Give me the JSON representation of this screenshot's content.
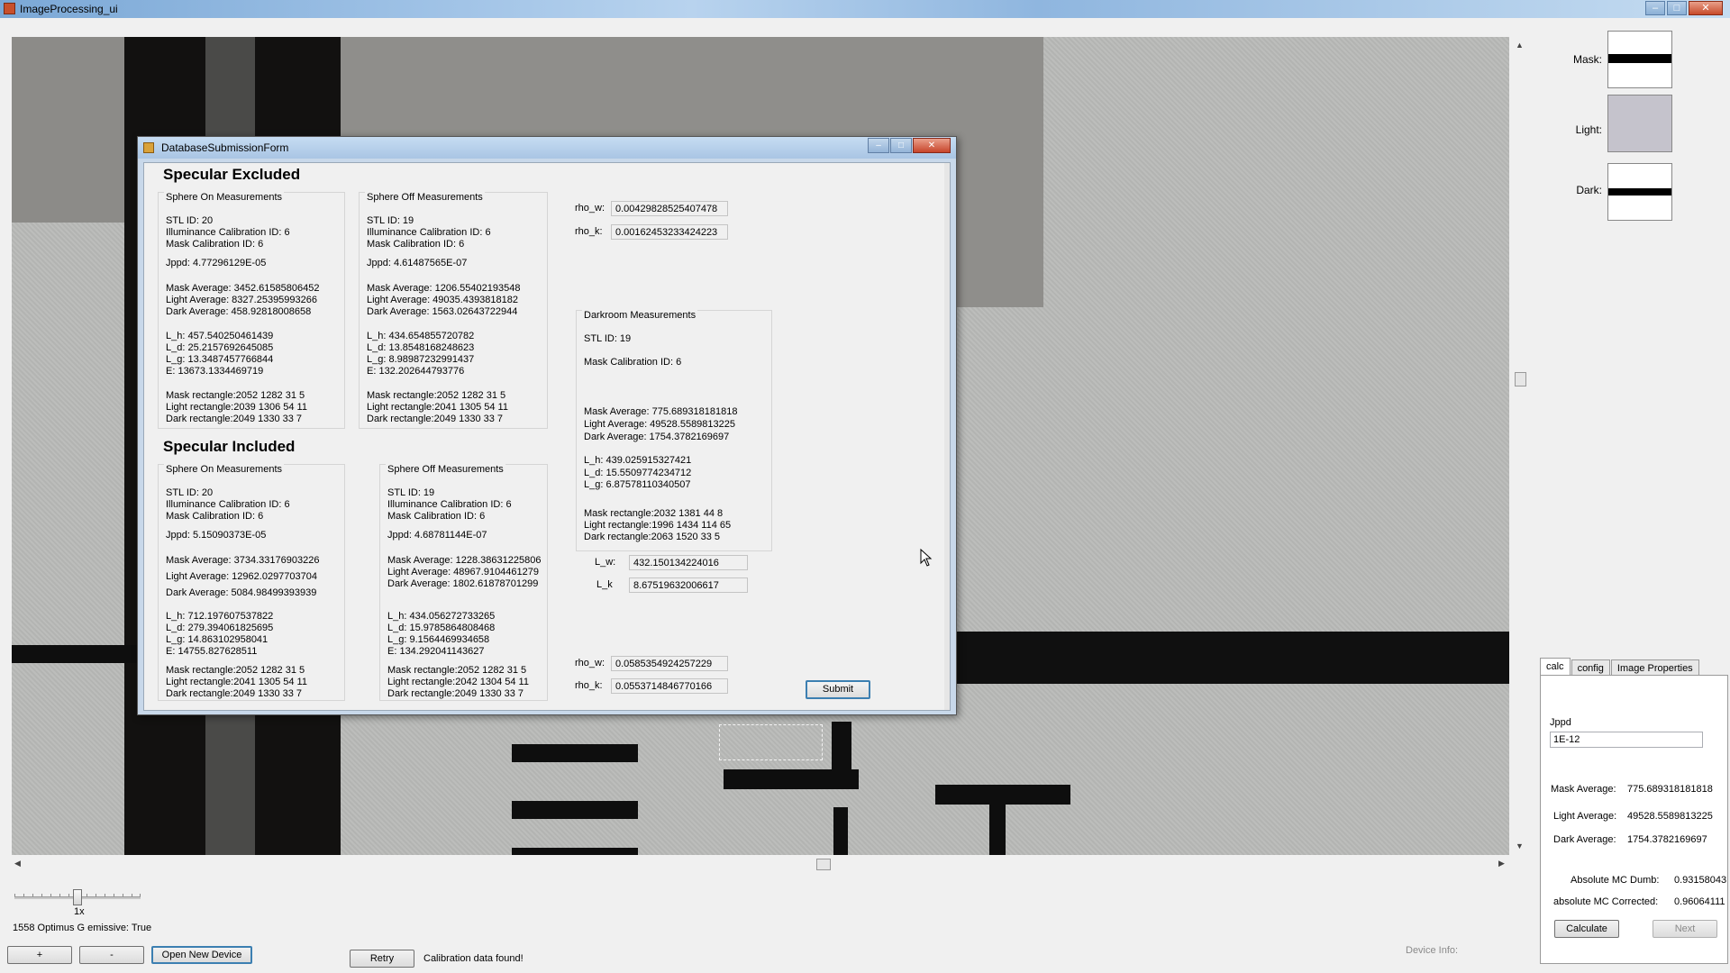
{
  "app": {
    "title": "ImageProcessing_ui",
    "window_buttons": {
      "minimize": "–",
      "maximize": "□",
      "close": "✕"
    }
  },
  "swatches": [
    {
      "label": "Mask:",
      "color": "#ffffff",
      "band_color": "#000000"
    },
    {
      "label": "Light:",
      "color": "#c5c3cc",
      "band_color": ""
    },
    {
      "label": "Dark:",
      "color": "#ffffff",
      "band_color": "#000000"
    }
  ],
  "right_panel": {
    "tabs": [
      {
        "label": "calc",
        "active": true
      },
      {
        "label": "config",
        "active": false
      },
      {
        "label": "Image Properties",
        "active": false
      }
    ],
    "jppd_label": "Jppd",
    "jppd_value": "1E-12",
    "mask_average_label": "Mask Average:",
    "mask_average_value": "775.689318181818",
    "light_average_label": "Light Average:",
    "light_average_value": "49528.5589813225",
    "dark_average_label": "Dark Average:",
    "dark_average_value": "1754.3782169697",
    "abs_mc_dumb_label": "Absolute MC Dumb:",
    "abs_mc_dumb_value": "0.93158043",
    "abs_mc_corrected_label": "absolute MC Corrected:",
    "abs_mc_corrected_value": "0.96064111",
    "calculate_label": "Calculate",
    "next_label": "Next"
  },
  "bottom": {
    "zoom_label": "1x",
    "device_line": "1558 Optimus G emissive: True",
    "plus_label": "+",
    "minus_label": "-",
    "open_device_label": "Open New Device",
    "retry_label": "Retry",
    "status": "Calibration data found!",
    "device_info_label": "Device Info:"
  },
  "dialog": {
    "title": "DatabaseSubmissionForm",
    "buttons": {
      "minimize": "–",
      "maximize": "□",
      "close": "✕"
    },
    "excluded": {
      "title": "Specular Excluded",
      "sphere_on": {
        "label": "Sphere On Measurements",
        "lines": [
          "STL ID: 20",
          "Illuminance Calibration ID: 6",
          "Mask Calibration ID: 6",
          "Jppd: 4.77296129E-05",
          "Mask Average: 3452.61585806452",
          "Light Average: 8327.25395993266",
          "Dark Average: 458.92818008658",
          "L_h: 457.540250461439",
          "L_d: 25.2157692645085",
          "L_g: 13.3487457766844",
          "E: 13673.1334469719",
          "Mask rectangle:2052 1282 31 5",
          "Light rectangle:2039 1306 54 11",
          "Dark rectangle:2049 1330 33 7"
        ]
      },
      "sphere_off": {
        "label": "Sphere Off Measurements",
        "lines": [
          "STL ID: 19",
          "Illuminance Calibration ID: 6",
          "Mask Calibration ID: 6",
          "Jppd: 4.61487565E-07",
          "Mask Average: 1206.55402193548",
          "Light Average: 49035.4393818182",
          "Dark Average: 1563.02643722944",
          "L_h: 434.654855720782",
          "L_d: 13.8548168248623",
          "L_g: 8.98987232991437",
          "E: 132.202644793776",
          "Mask rectangle:2052 1282 31 5",
          "Light rectangle:2041 1305 54 11",
          "Dark rectangle:2049 1330 33 7"
        ]
      },
      "rho_w_label": "rho_w:",
      "rho_w_value": "0.00429828525407478",
      "rho_k_label": "rho_k:",
      "rho_k_value": "0.00162453233424223"
    },
    "included": {
      "title": "Specular Included",
      "sphere_on": {
        "label": "Sphere On Measurements",
        "lines": [
          "STL ID: 20",
          "Illuminance Calibration ID: 6",
          "Mask Calibration ID: 6",
          "Jppd: 5.15090373E-05",
          "Mask Average: 3734.33176903226",
          "Light Average: 12962.0297703704",
          "Dark Average: 5084.98499393939",
          "L_h: 712.197607537822",
          "L_d: 279.394061825695",
          "L_g: 14.863102958041",
          "E: 14755.827628511",
          "Mask rectangle:2052 1282 31 5",
          "Light rectangle:2041 1305 54 11",
          "Dark rectangle:2049 1330 33 7"
        ]
      },
      "sphere_off": {
        "label": "Sphere Off Measurements",
        "lines": [
          "STL ID: 19",
          "Illuminance Calibration ID: 6",
          "Mask Calibration ID: 6",
          "Jppd: 4.68781144E-07",
          "Mask Average: 1228.38631225806",
          "Light Average: 48967.9104461279",
          "Dark Average: 1802.61878701299",
          "L_h: 434.056272733265",
          "L_d: 15.9785864808468",
          "L_g: 9.1564469934658",
          "E: 134.292041143627",
          "Mask rectangle:2052 1282 31 5",
          "Light rectangle:2042 1304 54 11",
          "Dark rectangle:2049 1330 33 7"
        ]
      },
      "rho_w_label": "rho_w:",
      "rho_w_value": "0.0585354924257229",
      "rho_k_label": "rho_k:",
      "rho_k_value": "0.0553714846770166"
    },
    "darkroom": {
      "label": "Darkroom Measurements",
      "lines": [
        "STL ID: 19",
        "Mask Calibration ID: 6",
        "Mask Average: 775.689318181818",
        "Light Average: 49528.5589813225",
        "Dark Average: 1754.3782169697",
        "L_h: 439.025915327421",
        "L_d: 15.5509774234712",
        "L_g: 6.87578110340507",
        "Mask rectangle:2032 1381 44 8",
        "Light rectangle:1996 1434 114 65",
        "Dark rectangle:2063 1520 33 5"
      ],
      "l_w_label": "L_w:",
      "l_w_value": "432.150134224016",
      "l_k_label": "L_k",
      "l_k_value": "8.67519632006617"
    },
    "submit_label": "Submit"
  }
}
